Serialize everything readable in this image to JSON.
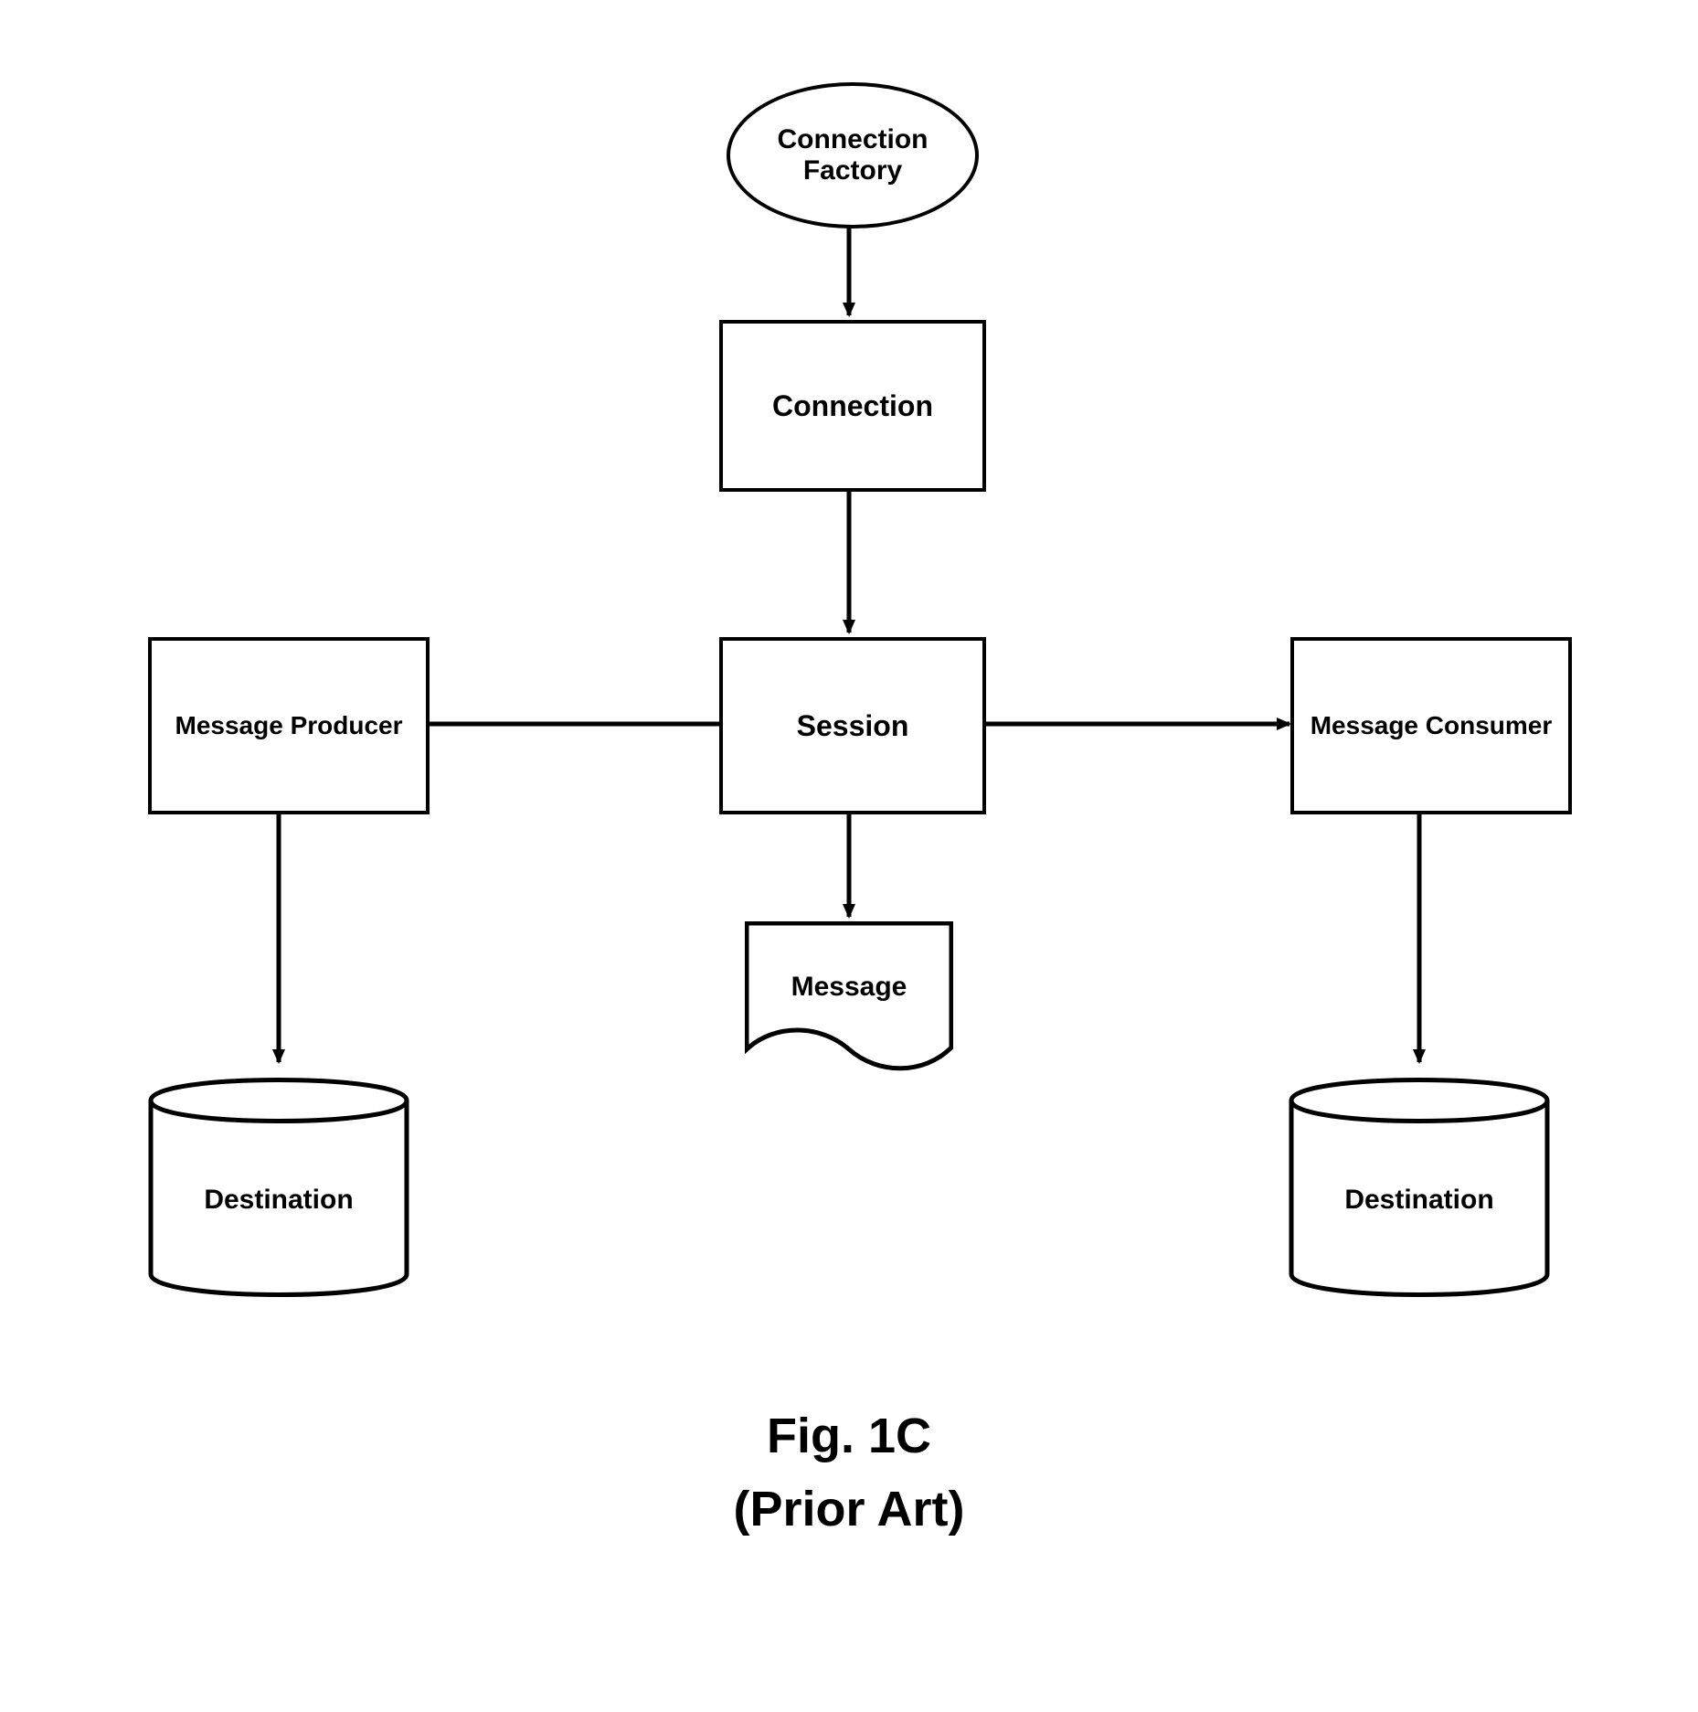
{
  "nodes": {
    "factory": "Connection\nFactory",
    "connection": "Connection",
    "session": "Session",
    "producer": "Message Producer",
    "consumer": "Message Consumer",
    "message": "Message",
    "dest_left": "Destination",
    "dest_right": "Destination"
  },
  "caption": {
    "line1": "Fig. 1C",
    "line2": "(Prior Art)"
  },
  "chart_data": {
    "type": "diagram",
    "title": "Fig. 1C (Prior Art)",
    "nodes": [
      {
        "id": "factory",
        "label": "Connection Factory",
        "shape": "ellipse"
      },
      {
        "id": "connection",
        "label": "Connection",
        "shape": "rectangle"
      },
      {
        "id": "session",
        "label": "Session",
        "shape": "rectangle"
      },
      {
        "id": "producer",
        "label": "Message Producer",
        "shape": "rectangle"
      },
      {
        "id": "consumer",
        "label": "Message Consumer",
        "shape": "rectangle"
      },
      {
        "id": "message",
        "label": "Message",
        "shape": "document"
      },
      {
        "id": "dest_left",
        "label": "Destination",
        "shape": "cylinder"
      },
      {
        "id": "dest_right",
        "label": "Destination",
        "shape": "cylinder"
      }
    ],
    "edges": [
      {
        "from": "factory",
        "to": "connection"
      },
      {
        "from": "connection",
        "to": "session"
      },
      {
        "from": "session",
        "to": "producer"
      },
      {
        "from": "session",
        "to": "consumer"
      },
      {
        "from": "session",
        "to": "message"
      },
      {
        "from": "producer",
        "to": "dest_left"
      },
      {
        "from": "consumer",
        "to": "dest_right"
      }
    ]
  }
}
